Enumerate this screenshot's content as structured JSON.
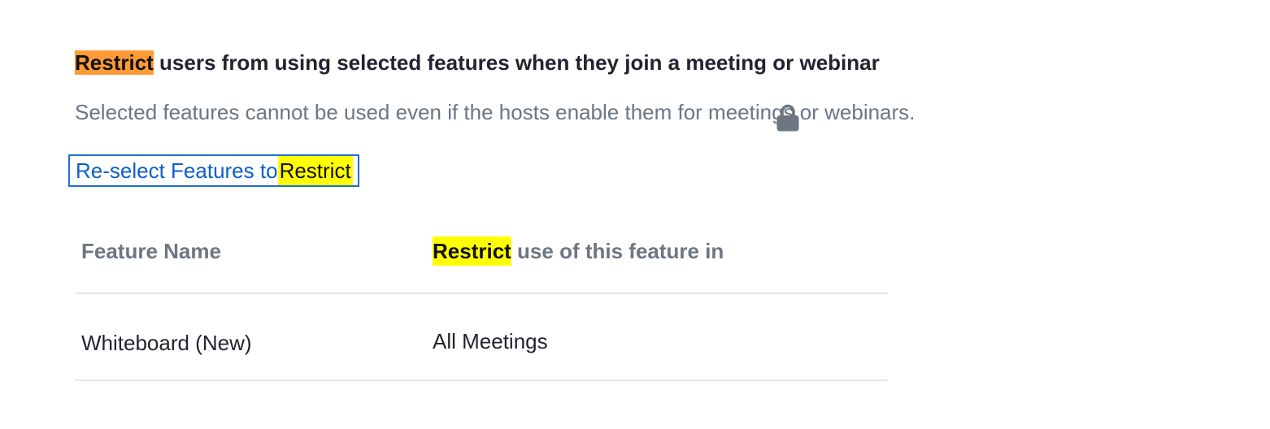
{
  "setting": {
    "title_highlight": "Restrict",
    "title_rest": " users from using selected features when they join a meeting or webinar",
    "description": "Selected features cannot be used even if the hosts enable them for meetings or webinars.",
    "reselect_link": {
      "prefix": "Re-select Features to ",
      "highlight": "Restrict"
    }
  },
  "table": {
    "columns": {
      "feature_name": "Feature Name",
      "restrict_highlight": "Restrict",
      "restrict_rest": " use of this feature in"
    },
    "rows": [
      {
        "feature": "Whiteboard (New)",
        "scope": "All Meetings",
        "locked": true,
        "icon": "lock-icon"
      }
    ]
  },
  "colors": {
    "highlight_orange": "#ff9b37",
    "highlight_yellow": "#ffff00",
    "link_blue": "#0e5ec9",
    "focus_border": "#1f6fd1",
    "heading_text": "#23232f",
    "muted_text": "#6e7680",
    "divider": "#e7e8ea",
    "lock_icon": "#6e7680"
  }
}
